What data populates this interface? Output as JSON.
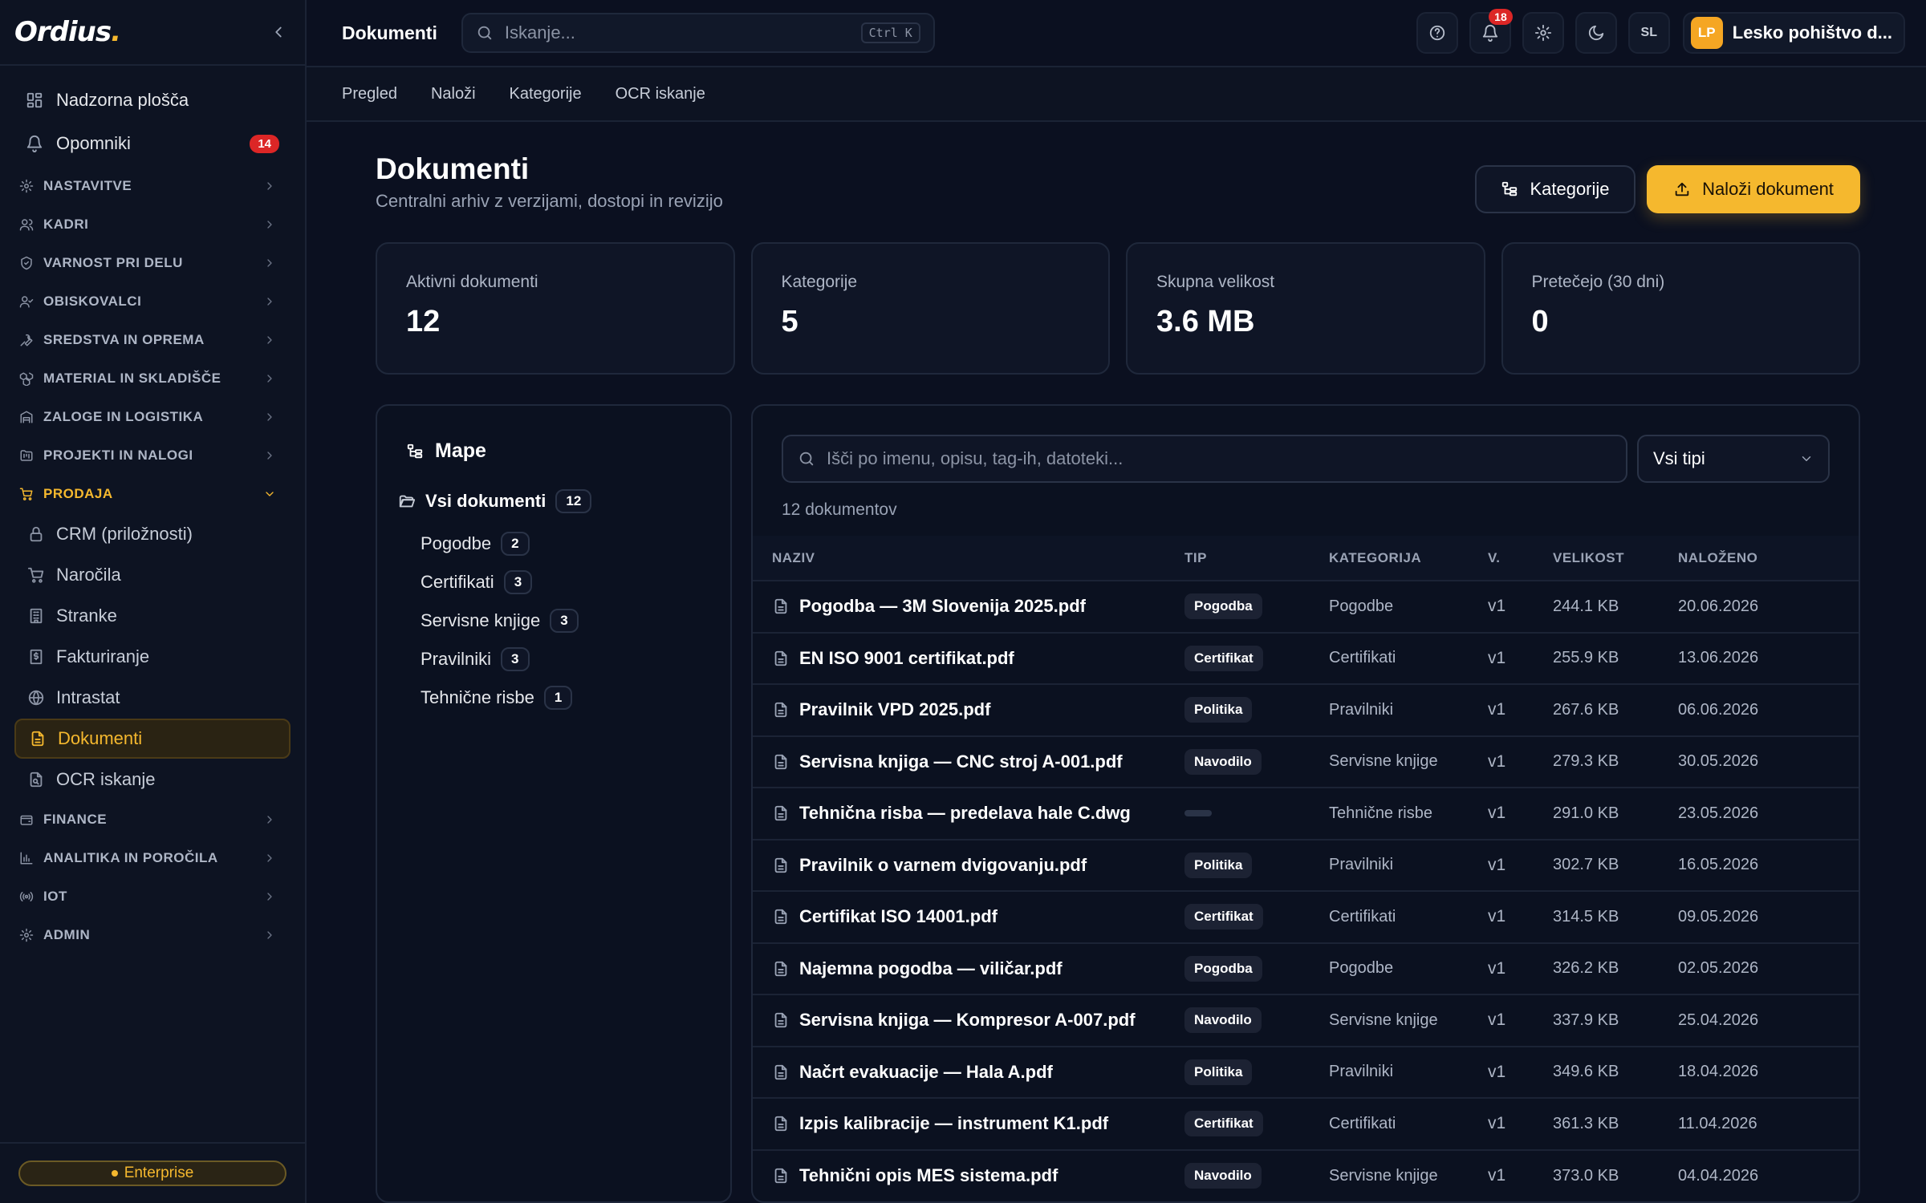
{
  "app": {
    "logo": "Ordius",
    "logo_dot": "."
  },
  "sidebar": {
    "top_items": [
      {
        "label": "Nadzorna plošča",
        "icon": "dashboard-icon"
      },
      {
        "label": "Opomniki",
        "icon": "bell-icon",
        "badge": "14"
      }
    ],
    "groups": [
      {
        "label": "NASTAVITVE",
        "icon": "gear-icon"
      },
      {
        "label": "KADRI",
        "icon": "users-icon"
      },
      {
        "label": "VARNOST PRI DELU",
        "icon": "shield-icon"
      },
      {
        "label": "OBISKOVALCI",
        "icon": "user-check-icon"
      },
      {
        "label": "SREDSTVA IN OPREMA",
        "icon": "wrench-icon"
      },
      {
        "label": "MATERIAL IN SKLADIŠČE",
        "icon": "boxes-icon"
      },
      {
        "label": "ZALOGE IN LOGISTIKA",
        "icon": "warehouse-icon"
      },
      {
        "label": "PROJEKTI IN NALOGI",
        "icon": "folder-kanban-icon"
      },
      {
        "label": "PRODAJA",
        "icon": "cart-icon"
      },
      {
        "label": "FINANCE",
        "icon": "wallet-icon"
      },
      {
        "label": "ANALITIKA IN POROČILA",
        "icon": "bar-chart-icon"
      },
      {
        "label": "IOT",
        "icon": "radio-icon"
      },
      {
        "label": "ADMIN",
        "icon": "gear-icon"
      }
    ],
    "prodaja_items": [
      {
        "label": "CRM (priložnosti)",
        "icon": "lock-icon"
      },
      {
        "label": "Naročila",
        "icon": "cart-icon"
      },
      {
        "label": "Stranke",
        "icon": "building-icon"
      },
      {
        "label": "Fakturiranje",
        "icon": "invoice-icon"
      },
      {
        "label": "Intrastat",
        "icon": "globe-icon"
      },
      {
        "label": "Dokumenti",
        "icon": "document-icon"
      },
      {
        "label": "OCR iskanje",
        "icon": "scan-document-icon"
      }
    ],
    "plan": "Enterprise"
  },
  "topbar": {
    "title": "Dokumenti",
    "search_placeholder": "Iskanje...",
    "shortcut": "Ctrl K",
    "notifications": "18",
    "language": "SL",
    "org_initials": "LP",
    "org_name": "Lesko pohištvo d..."
  },
  "subtabs": [
    "Pregled",
    "Naloži",
    "Kategorije",
    "OCR iskanje"
  ],
  "page": {
    "title": "Dokumenti",
    "subtitle": "Centralni arhiv z verzijami, dostopi in revizijo",
    "btn_categories": "Kategorije",
    "btn_upload": "Naloži dokument"
  },
  "stats": [
    {
      "label": "Aktivni dokumenti",
      "value": "12"
    },
    {
      "label": "Kategorije",
      "value": "5"
    },
    {
      "label": "Skupna velikost",
      "value": "3.6 MB"
    },
    {
      "label": "Pretečejo (30 dni)",
      "value": "0"
    }
  ],
  "folders": {
    "title": "Mape",
    "all_label": "Vsi dokumenti",
    "all_count": "12",
    "items": [
      {
        "label": "Pogodbe",
        "count": "2"
      },
      {
        "label": "Certifikati",
        "count": "3"
      },
      {
        "label": "Servisne knjige",
        "count": "3"
      },
      {
        "label": "Pravilniki",
        "count": "3"
      },
      {
        "label": "Tehnične risbe",
        "count": "1"
      }
    ]
  },
  "documents": {
    "search_placeholder": "Išči po imenu, opisu, tag-ih, datoteki...",
    "type_filter": "Vsi tipi",
    "count_text": "12 dokumentov",
    "columns": [
      "NAZIV",
      "TIP",
      "KATEGORIJA",
      "V.",
      "VELIKOST",
      "NALOŽENO"
    ],
    "rows": [
      {
        "name": "Pogodba — 3M Slovenija 2025.pdf",
        "type": "Pogodba",
        "category": "Pogodbe",
        "version": "v1",
        "size": "244.1 KB",
        "uploaded": "20.06.2026"
      },
      {
        "name": "EN ISO 9001 certifikat.pdf",
        "type": "Certifikat",
        "category": "Certifikati",
        "version": "v1",
        "size": "255.9 KB",
        "uploaded": "13.06.2026"
      },
      {
        "name": "Pravilnik VPD 2025.pdf",
        "type": "Politika",
        "category": "Pravilniki",
        "version": "v1",
        "size": "267.6 KB",
        "uploaded": "06.06.2026"
      },
      {
        "name": "Servisna knjiga — CNC stroj A-001.pdf",
        "type": "Navodilo",
        "category": "Servisne knjige",
        "version": "v1",
        "size": "279.3 KB",
        "uploaded": "30.05.2026"
      },
      {
        "name": "Tehnična risba — predelava hale C.dwg",
        "type": "",
        "category": "Tehnične risbe",
        "version": "v1",
        "size": "291.0 KB",
        "uploaded": "23.05.2026"
      },
      {
        "name": "Pravilnik o varnem dvigovanju.pdf",
        "type": "Politika",
        "category": "Pravilniki",
        "version": "v1",
        "size": "302.7 KB",
        "uploaded": "16.05.2026"
      },
      {
        "name": "Certifikat ISO 14001.pdf",
        "type": "Certifikat",
        "category": "Certifikati",
        "version": "v1",
        "size": "314.5 KB",
        "uploaded": "09.05.2026"
      },
      {
        "name": "Najemna pogodba — viličar.pdf",
        "type": "Pogodba",
        "category": "Pogodbe",
        "version": "v1",
        "size": "326.2 KB",
        "uploaded": "02.05.2026"
      },
      {
        "name": "Servisna knjiga — Kompresor A-007.pdf",
        "type": "Navodilo",
        "category": "Servisne knjige",
        "version": "v1",
        "size": "337.9 KB",
        "uploaded": "25.04.2026"
      },
      {
        "name": "Načrt evakuacije — Hala A.pdf",
        "type": "Politika",
        "category": "Pravilniki",
        "version": "v1",
        "size": "349.6 KB",
        "uploaded": "18.04.2026"
      },
      {
        "name": "Izpis kalibracije — instrument K1.pdf",
        "type": "Certifikat",
        "category": "Certifikati",
        "version": "v1",
        "size": "361.3 KB",
        "uploaded": "11.04.2026"
      },
      {
        "name": "Tehnični opis MES sistema.pdf",
        "type": "Navodilo",
        "category": "Servisne knjige",
        "version": "v1",
        "size": "373.0 KB",
        "uploaded": "04.04.2026"
      }
    ]
  },
  "colors": {
    "accent": "#f5b82e",
    "background": "#0b1020",
    "danger": "#dc2626"
  }
}
